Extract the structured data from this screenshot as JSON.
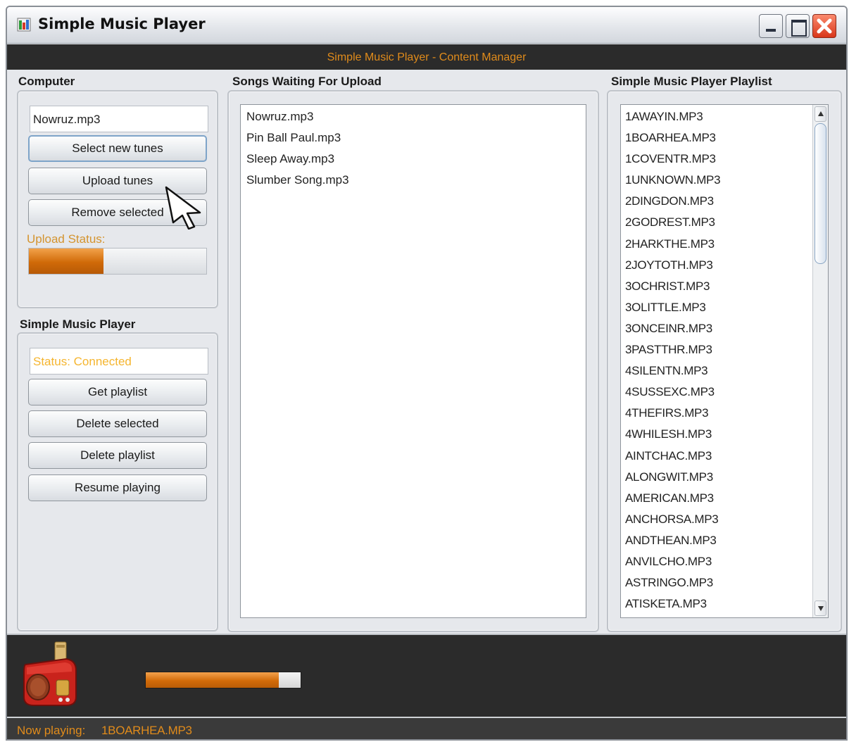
{
  "window": {
    "title": "Simple Music Player",
    "header_title": "Simple Music Player - Content Manager"
  },
  "computer": {
    "section_label": "Computer",
    "selected_file": "Nowruz.mp3",
    "buttons": {
      "select_new_tunes": "Select new tunes",
      "upload_tunes": "Upload tunes",
      "remove_selected": "Remove selected"
    },
    "upload_status_label": "Upload Status:",
    "upload_progress": 0.42
  },
  "player": {
    "section_label": "Simple Music Player",
    "status_text": "Status: Connected",
    "buttons": {
      "get_playlist": "Get playlist",
      "delete_selected": "Delete selected",
      "delete_playlist": "Delete playlist",
      "resume_playing": "Resume playing"
    }
  },
  "upload_queue": {
    "section_label": "Songs Waiting For Upload",
    "songs": [
      "Nowruz.mp3",
      "Pin Ball Paul.mp3",
      "Sleep Away.mp3",
      "Slumber Song.mp3"
    ]
  },
  "playlist": {
    "section_label": "Simple Music Player Playlist",
    "items": [
      "1AWAYIN.MP3",
      "1BOARHEA.MP3",
      "1COVENTR.MP3",
      "1UNKNOWN.MP3",
      "2DINGDON.MP3",
      "2GODREST.MP3",
      "2HARKTHE.MP3",
      "2JOYTOTH.MP3",
      "3OCHRIST.MP3",
      "3OLITTLE.MP3",
      "3ONCEINR.MP3",
      "3PASTTHR.MP3",
      "4SILENTN.MP3",
      "4SUSSEXC.MP3",
      "4THEFIRS.MP3",
      "4WHILESH.MP3",
      "AINTCHAC.MP3",
      "ALONGWIT.MP3",
      "AMERICAN.MP3",
      "ANCHORSA.MP3",
      "ANDTHEAN.MP3",
      "ANVILCHO.MP3",
      "ASTRINGO.MP3",
      "ATISKETA.MP3"
    ]
  },
  "footer": {
    "playback_progress": 0.86,
    "now_playing_label": "Now playing:",
    "now_playing_value": "1BOARHEA.MP3"
  },
  "colors": {
    "accent_orange": "#e08b1b",
    "dark_bar": "#2b2b2b",
    "panel_bg": "#e6e8ec"
  },
  "icons": [
    "app-icon",
    "minimize-icon",
    "maximize-icon",
    "close-icon",
    "scroll-up-icon",
    "scroll-down-icon",
    "radio-icon",
    "mouse-cursor-icon"
  ]
}
